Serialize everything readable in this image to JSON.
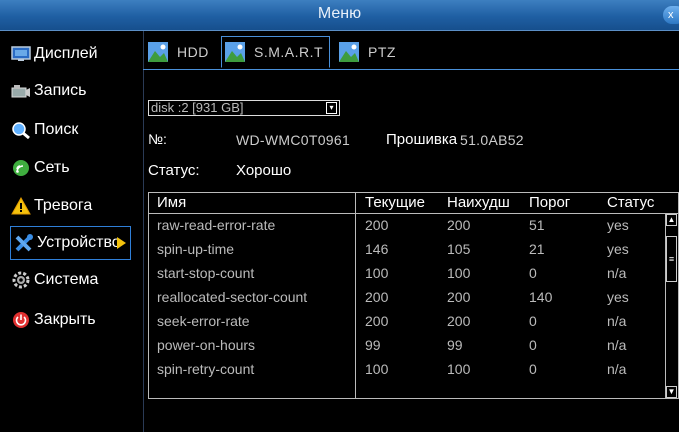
{
  "window": {
    "title": "Меню",
    "close_label": "x"
  },
  "sidebar": {
    "items": [
      {
        "label": "Дисплей",
        "icon": "monitor-icon"
      },
      {
        "label": "Запись",
        "icon": "record-icon"
      },
      {
        "label": "Поиск",
        "icon": "search-icon"
      },
      {
        "label": "Сеть",
        "icon": "network-icon"
      },
      {
        "label": "Тревога",
        "icon": "warning-icon"
      },
      {
        "label": "Устройство",
        "icon": "tools-icon"
      },
      {
        "label": "Система",
        "icon": "gear-icon"
      },
      {
        "label": "Закрыть",
        "icon": "power-icon"
      }
    ],
    "active_index": 5
  },
  "tabs": [
    {
      "label": "HDD"
    },
    {
      "label": "S.M.A.R.T"
    },
    {
      "label": "PTZ"
    }
  ],
  "active_tab": 1,
  "disk": {
    "selected": "disk :2 [931 GB]",
    "arrow": "▾"
  },
  "info": {
    "number_label": "№:",
    "serial": "WD-WMC0T0961",
    "firmware_label": "Прошивка",
    "firmware": "51.0AB52",
    "status_label": "Статус:",
    "status_value": "Хорошо"
  },
  "table": {
    "headers": [
      "Имя",
      "Текущие",
      "Наихудш",
      "Порог",
      "Статус"
    ],
    "rows": [
      [
        "raw-read-error-rate",
        "200",
        "200",
        "51",
        "yes"
      ],
      [
        "spin-up-time",
        "146",
        "105",
        "21",
        "yes"
      ],
      [
        "start-stop-count",
        "100",
        "100",
        "0",
        "n/a"
      ],
      [
        "reallocated-sector-count",
        "200",
        "200",
        "140",
        "yes"
      ],
      [
        "seek-error-rate",
        "200",
        "200",
        "0",
        "n/a"
      ],
      [
        "power-on-hours",
        "99",
        "99",
        "0",
        "n/a"
      ],
      [
        "spin-retry-count",
        "100",
        "100",
        "0",
        "n/a"
      ]
    ],
    "scroll_up": "▲",
    "scroll_down": "▼",
    "scroll_thumb": "≡"
  },
  "colors": {
    "titlebar": "#1f5fa3",
    "accent": "#4a90d9",
    "background": "#000000"
  }
}
